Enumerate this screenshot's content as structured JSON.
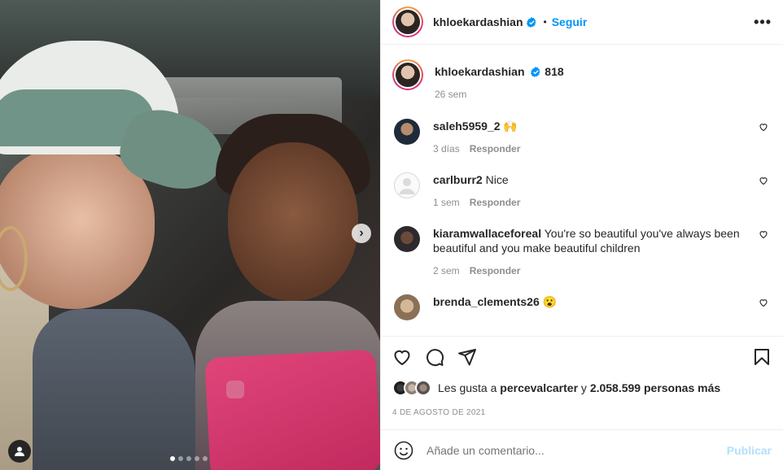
{
  "post": {
    "author": "khloekardashian",
    "follow_label": "Seguir",
    "separator": "•",
    "more_label": "•••",
    "caption_text": "818",
    "caption_age": "26 sem",
    "next_label": "›"
  },
  "comments": [
    {
      "username": "saleh5959_2",
      "text": "🙌",
      "age": "3 días",
      "reply": "Responder"
    },
    {
      "username": "carlburr2",
      "text": "Nice",
      "age": "1 sem",
      "reply": "Responder"
    },
    {
      "username": "kiaramwallaceforeal",
      "text": "You're so beautiful you've always been beautiful and you make beautiful children",
      "age": "2 sem",
      "reply": "Responder"
    },
    {
      "username": "brenda_clements26",
      "text": "😮",
      "age": "",
      "reply": ""
    }
  ],
  "likes": {
    "prefix": "Les gusta a",
    "user": "percevalcarter",
    "conj": "y",
    "count_text": "2.058.599 personas más"
  },
  "date": "4 de agosto de 2021",
  "add_comment": {
    "placeholder": "Añade un comentario...",
    "publish_label": "Publicar"
  },
  "carousel": {
    "total": 5,
    "active_index": 0
  },
  "colors": {
    "link": "#0095f6",
    "muted": "#8e8e8e",
    "publish_disabled": "#b2dffc",
    "verified": "#0095f6"
  }
}
